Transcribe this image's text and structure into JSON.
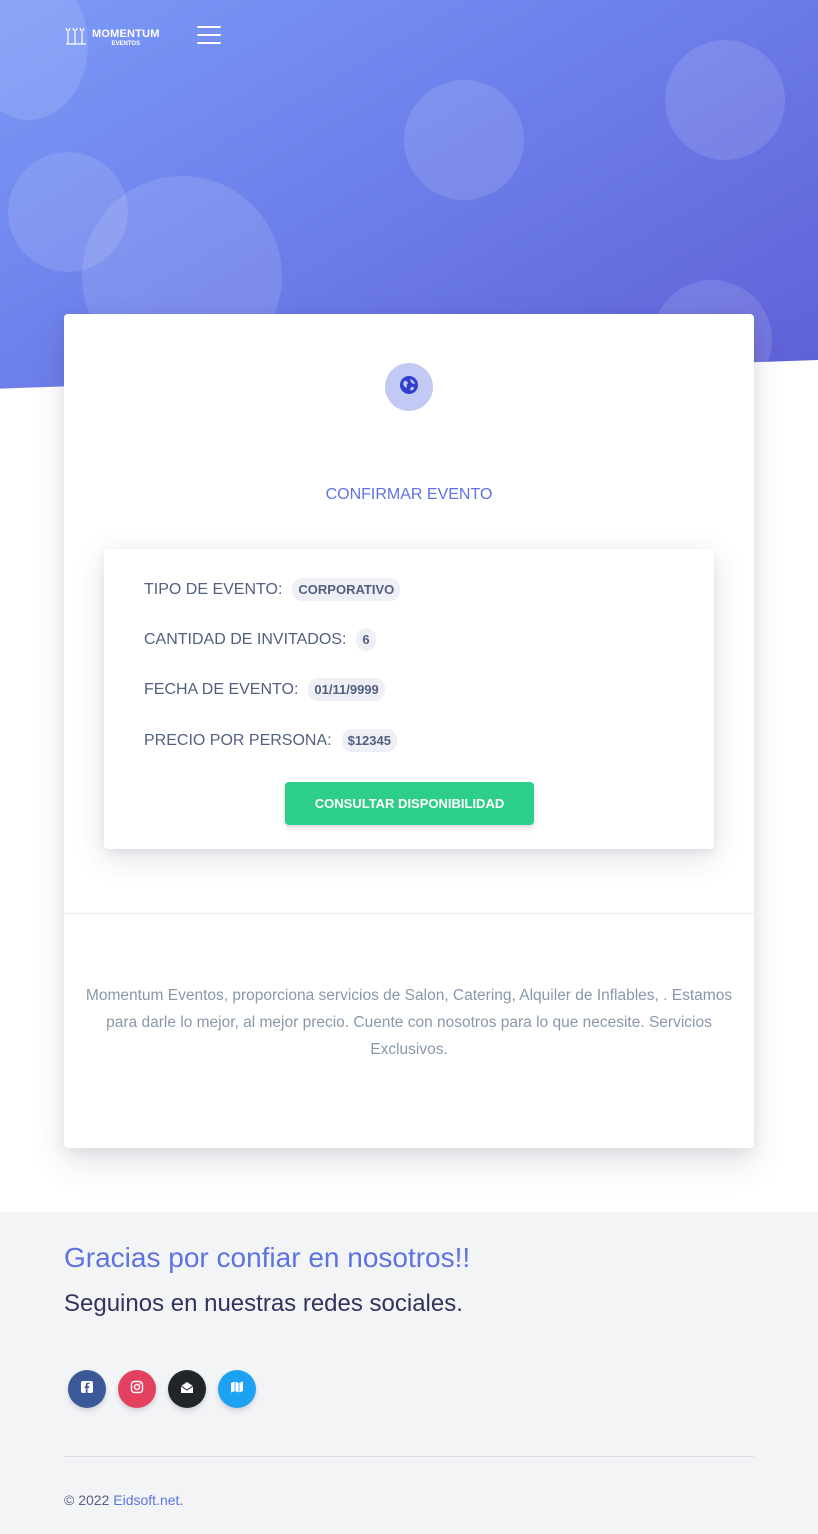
{
  "brand": {
    "name": "MOMENTUM",
    "sub": "EVENTOS"
  },
  "card": {
    "title": "CONFIRMAR EVENTO",
    "details": [
      {
        "label": "TIPO DE EVENTO:",
        "value": "CORPORATIVO"
      },
      {
        "label": "CANTIDAD DE INVITADOS:",
        "value": "6"
      },
      {
        "label": "FECHA DE EVENTO:",
        "value": "01/11/9999"
      },
      {
        "label": "PRECIO POR PERSONA:",
        "value": "$12345"
      }
    ],
    "button_label": "CONSULTAR DISPONIBILIDAD",
    "description": "Momentum Eventos, proporciona servicios de Salon, Catering, Alquiler de Inflables, . Estamos para darle lo mejor, al mejor precio. Cuente con nosotros para lo que necesite. Servicios Exclusivos."
  },
  "footer": {
    "thanks": "Gracias por confiar en nosotros!!",
    "follow": "Seguinos en nuestras redes sociales.",
    "social": [
      {
        "icon": "facebook-icon",
        "color": "#3b5998"
      },
      {
        "icon": "instagram-icon",
        "color": "#e4405f"
      },
      {
        "icon": "envelope-open-icon",
        "color": "#212529"
      },
      {
        "icon": "map-icon",
        "color": "#1da1f2"
      }
    ],
    "copyright_prefix": "© 2022",
    "copyright_link": "Eidsoft.net",
    "copyright_suffix": "."
  },
  "colors": {
    "primary": "#5e72e4",
    "success": "#2dce89",
    "hero_start": "#7b9af7",
    "hero_end": "#5f5fd6"
  }
}
